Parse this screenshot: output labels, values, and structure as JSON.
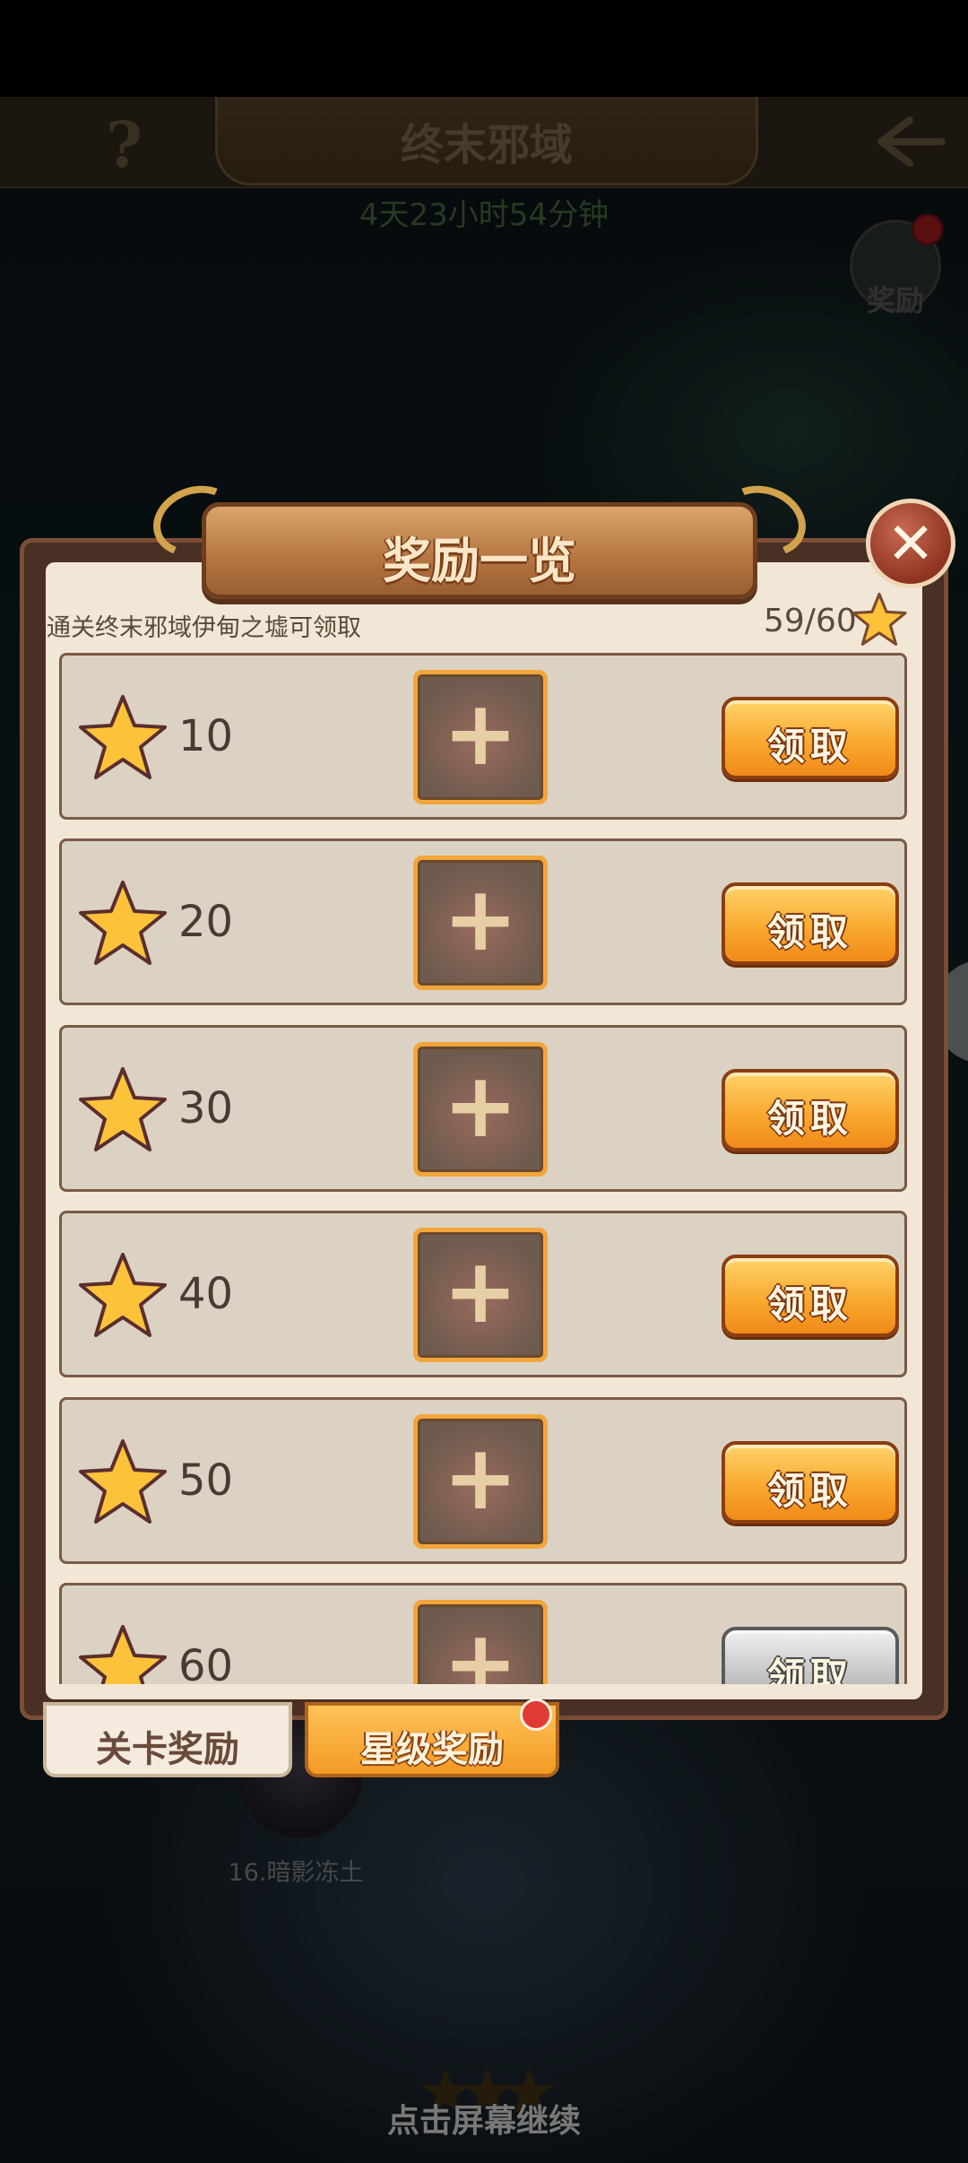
{
  "header": {
    "title": "终末邪域",
    "help_icon": "?",
    "timer": "4天23小时54分钟",
    "reward_label": "奖励"
  },
  "map": {
    "stage_label": "16.暗影冻土",
    "continue_hint": "点击屏幕继续"
  },
  "dialog": {
    "title": "奖励一览",
    "close_icon": "✕",
    "hint": "通关终末邪域伊甸之墟可领取",
    "progress": "59/60",
    "rows": [
      {
        "stars": "10",
        "claim": "领取",
        "enabled": true
      },
      {
        "stars": "20",
        "claim": "领取",
        "enabled": true
      },
      {
        "stars": "30",
        "claim": "领取",
        "enabled": true
      },
      {
        "stars": "40",
        "claim": "领取",
        "enabled": true
      },
      {
        "stars": "50",
        "claim": "领取",
        "enabled": true
      },
      {
        "stars": "60",
        "claim": "领取",
        "enabled": false
      }
    ]
  },
  "tabs": {
    "level_rewards": "关卡奖励",
    "star_rewards": "星级奖励",
    "active": "star_rewards"
  },
  "colors": {
    "accent": "#f9a930",
    "panel_bg": "#f2e7d7",
    "row_bg": "#dcd2c3",
    "disabled": "#c8c8c8",
    "notification": "#e03a34"
  },
  "icons": {
    "star": "star-icon",
    "plus": "plus-icon",
    "close": "close-icon",
    "back": "back-arrow-icon",
    "help": "help-icon"
  }
}
